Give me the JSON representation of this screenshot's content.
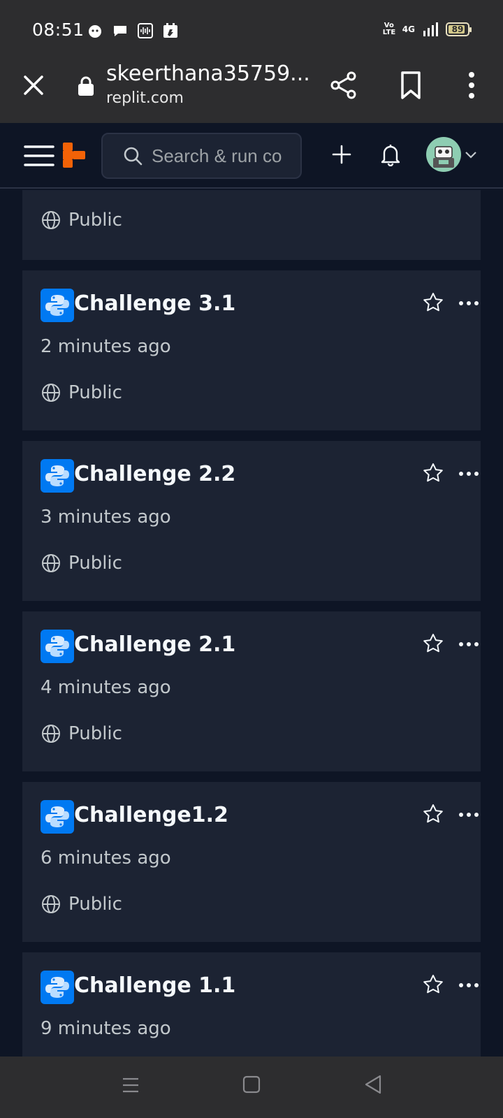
{
  "status_bar": {
    "time": "08:51",
    "network": "4G",
    "volte": "Vo LTE",
    "battery_level": "89",
    "battery_percent": 89
  },
  "browser": {
    "page_title": "skeerthana35759...",
    "domain": "replit.com"
  },
  "header": {
    "search_placeholder": "Search & run co"
  },
  "colors": {
    "background": "#0e1525",
    "card": "#1c2333",
    "accent_logo": "#f26207",
    "python_blue": "#0079f2"
  },
  "repls": [
    {
      "title": "",
      "time": "",
      "visibility": "Public"
    },
    {
      "title": "Challenge 3.1",
      "time": "2 minutes ago",
      "visibility": "Public"
    },
    {
      "title": "Challenge 2.2",
      "time": "3 minutes ago",
      "visibility": "Public"
    },
    {
      "title": "Challenge 2.1",
      "time": "4 minutes ago",
      "visibility": "Public"
    },
    {
      "title": "Challenge1.2",
      "time": "6 minutes ago",
      "visibility": "Public"
    },
    {
      "title": "Challenge 1.1",
      "time": "9 minutes ago",
      "visibility": ""
    }
  ],
  "icons": {
    "close": "close-icon",
    "lock": "lock-icon",
    "share": "share-icon",
    "bookmark": "bookmark-icon",
    "more": "more-vertical-icon",
    "menu": "hamburger-icon",
    "search": "search-icon",
    "add": "plus-icon",
    "notifications": "bell-icon",
    "language": "python-icon",
    "favorite": "star-icon",
    "options": "more-horizontal-icon",
    "visibility": "globe-icon"
  }
}
